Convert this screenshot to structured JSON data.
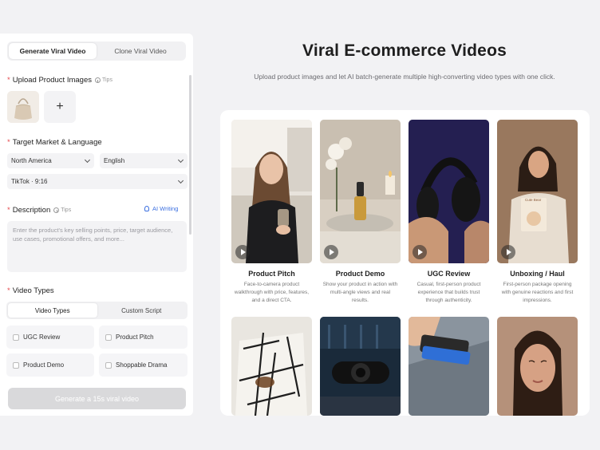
{
  "panel": {
    "mode_tabs": [
      "Generate Viral Video",
      "Clone Viral Video"
    ],
    "upload_label": "Upload Product Images",
    "tips": "Tips",
    "add_symbol": "+",
    "target_label": "Target Market & Language",
    "market": "North America",
    "language": "English",
    "platform": "TikTok · 9:16",
    "description_label": "Description",
    "ai_writing": "AI Writing",
    "description_placeholder": "Enter the product's key selling points, price, target audience, use cases, promotional offers, and more...",
    "video_types_label": "Video Types",
    "type_tabs": [
      "Video Types",
      "Custom Script"
    ],
    "options": [
      "UGC Review",
      "Product Pitch",
      "Product Demo",
      "Shoppable Drama"
    ],
    "generate_label": "Generate a 15s viral video"
  },
  "main": {
    "title": "Viral E-commerce Videos",
    "subtitle": "Upload product images and let AI batch-generate multiple high-converting video types with one click.",
    "cards": [
      {
        "title": "Product Pitch",
        "desc": "Face-to-camera product walkthrough with price, features, and a direct CTA."
      },
      {
        "title": "Product Demo",
        "desc": "Show your product in action with multi-angle views and real results."
      },
      {
        "title": "UGC Review",
        "desc": "Casual, first-person product experience that builds trust through authenticity."
      },
      {
        "title": "Unboxing / Haul",
        "desc": "First-person package opening with genuine reactions and first impressions."
      }
    ],
    "box_text": "Cute Bear"
  }
}
